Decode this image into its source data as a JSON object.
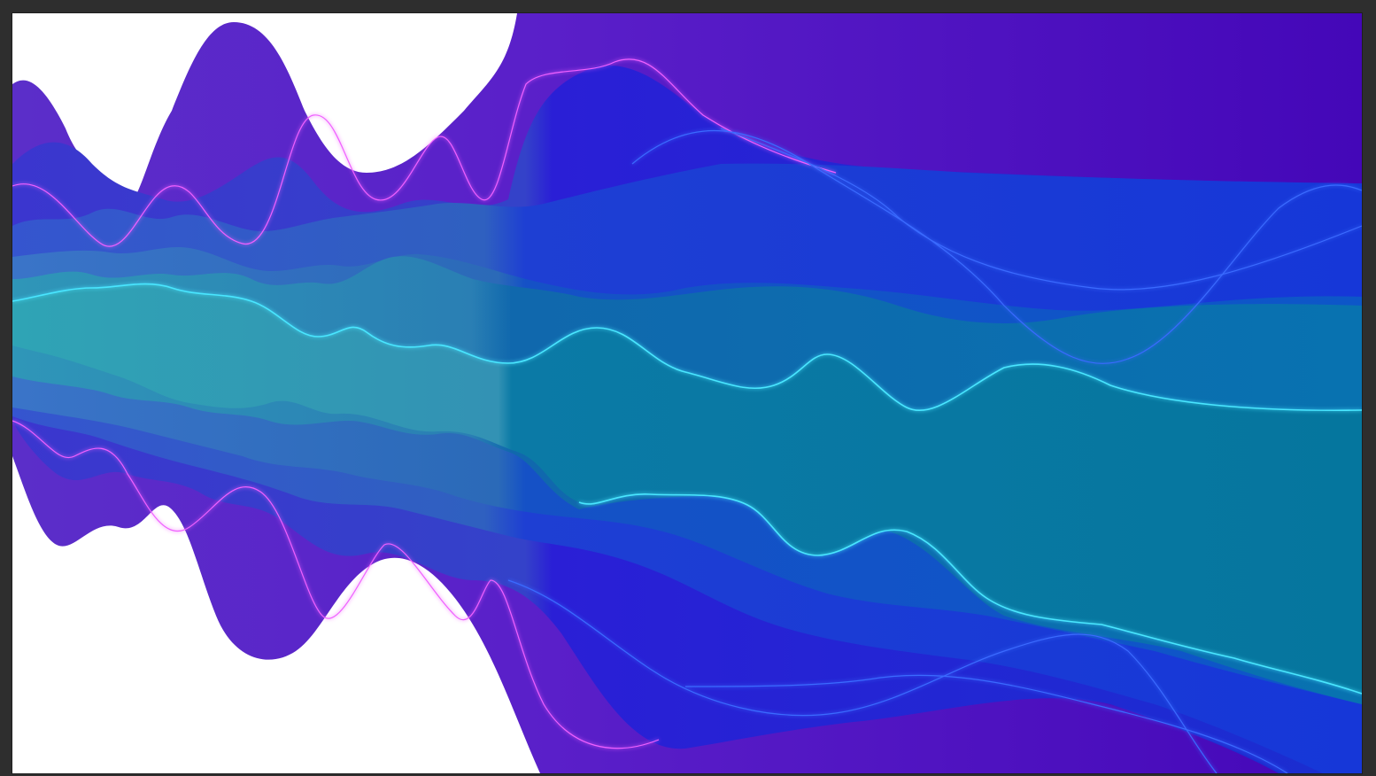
{
  "canvas": {
    "background": "#ffffff",
    "frame_background": "#2e2e2e"
  },
  "artwork": {
    "description_icon": "abstract-wave-artwork",
    "palette": {
      "violet": "#5a1fc9",
      "deep_violet": "#4407b8",
      "indigo": "#2a1fd6",
      "royal_blue": "#1637d8",
      "blue": "#0d56c8",
      "ocean": "#0872b0",
      "teal": "#1b8fb0",
      "cyan_glow": "#49e6ff",
      "magenta_glow": "#f060ff"
    }
  }
}
